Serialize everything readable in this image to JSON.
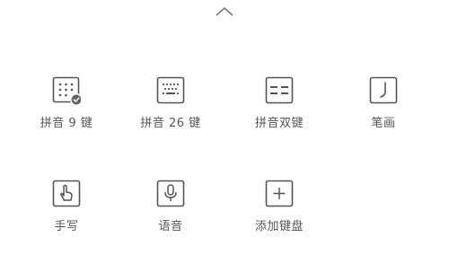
{
  "collapse": {
    "icon": "chevron-up-icon"
  },
  "keyboards": [
    {
      "label": "拼音 9 键",
      "icon": "nine-key-grid-icon",
      "selected": true
    },
    {
      "label": "拼音 26 键",
      "icon": "qwerty-keyboard-icon",
      "selected": false
    },
    {
      "label": "拼音双键",
      "icon": "double-pinyin-icon",
      "selected": false
    },
    {
      "label": "笔画",
      "icon": "stroke-icon",
      "selected": false
    },
    {
      "label": "手写",
      "icon": "hand-pointer-icon",
      "selected": false
    },
    {
      "label": "语音",
      "icon": "microphone-icon",
      "selected": false
    },
    {
      "label": "添加键盘",
      "icon": "plus-icon",
      "selected": false
    }
  ],
  "colors": {
    "icon_stroke": "#555555",
    "label": "#555555",
    "check_badge": "#666666",
    "background": "#ffffff"
  }
}
